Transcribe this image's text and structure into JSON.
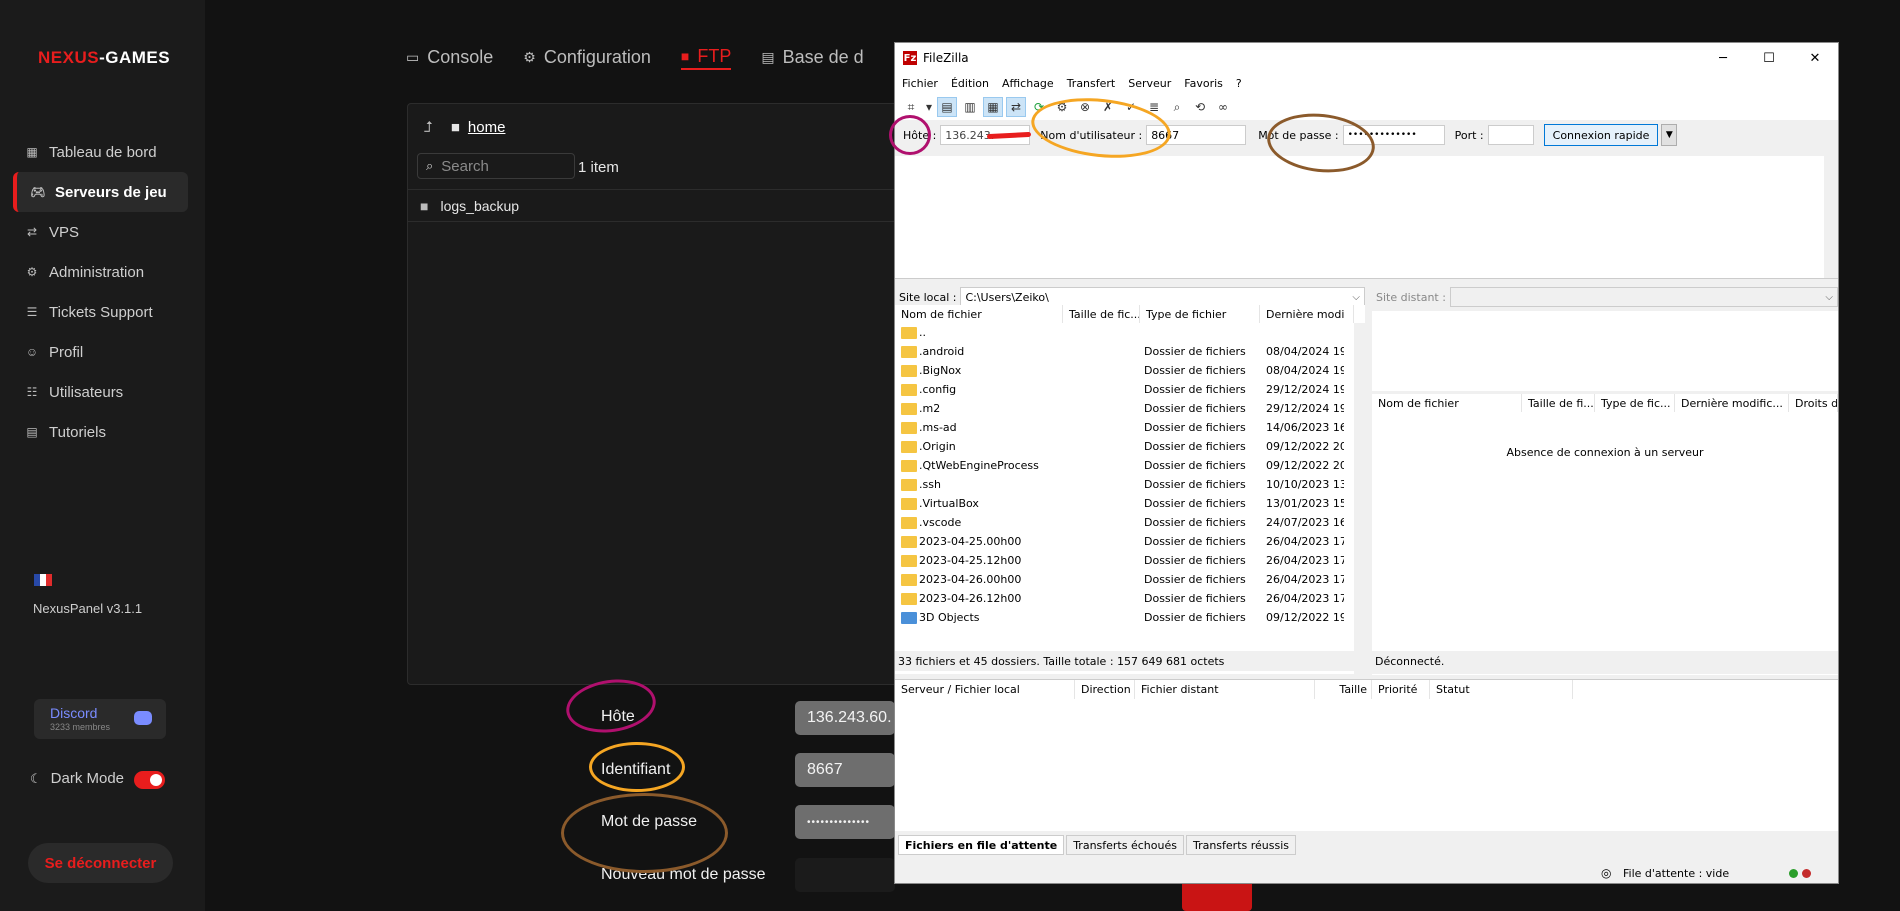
{
  "sidebar": {
    "logo_prefix": "NEXUS",
    "logo_suffix": "-GAMES",
    "items": [
      {
        "label": "Tableau de bord",
        "icon": "dashboard-icon"
      },
      {
        "label": "Serveurs de jeu",
        "icon": "gamepad-icon",
        "active": true
      },
      {
        "label": "VPS",
        "icon": "vps-icon"
      },
      {
        "label": "Administration",
        "icon": "gear-icon"
      },
      {
        "label": "Tickets Support",
        "icon": "ticket-icon"
      },
      {
        "label": "Profil",
        "icon": "user-icon"
      },
      {
        "label": "Utilisateurs",
        "icon": "users-icon"
      },
      {
        "label": "Tutoriels",
        "icon": "book-icon"
      }
    ],
    "version": "NexusPanel v3.1.1",
    "discord_label": "Discord",
    "discord_members": "3233 membres",
    "dark_mode_label": "Dark Mode",
    "logout_label": "Se déconnecter"
  },
  "main": {
    "tabs": [
      {
        "label": "Console",
        "icon": "terminal-icon"
      },
      {
        "label": "Configuration",
        "icon": "gears-icon"
      },
      {
        "label": "FTP",
        "icon": "folder-icon",
        "active": true
      },
      {
        "label": "Base de d",
        "icon": "database-icon"
      }
    ],
    "breadcrumb_home": "home",
    "search_placeholder": "Search",
    "item_count": "1 item",
    "files": [
      "logs_backup"
    ],
    "form": {
      "host_label": "Hôte",
      "host_value": "136.243.60.",
      "user_label": "Identifiant",
      "user_value": "8667",
      "password_label": "Mot de passe",
      "password_value": "••••••••••••••",
      "new_password_label": "Nouveau mot de passe"
    }
  },
  "filezilla": {
    "title": "FileZilla",
    "menu": [
      "Fichier",
      "Édition",
      "Affichage",
      "Transfert",
      "Serveur",
      "Favoris",
      "?"
    ],
    "quickconnect": {
      "host_label": "Hôte :",
      "host_value": "136.243.",
      "user_label": "Nom d'utilisateur :",
      "user_value": "8667",
      "pass_label": "Mot de passe :",
      "pass_value": "•••••••••••••",
      "port_label": "Port :",
      "port_value": "",
      "button": "Connexion rapide"
    },
    "local_site_label": "Site local :",
    "local_site_value": "C:\\Users\\Zeiko\\",
    "remote_site_label": "Site distant :",
    "local_columns": [
      "Nom de fichier",
      "Taille de fic...",
      "Type de fichier",
      "Dernière modi"
    ],
    "local_files": [
      {
        "name": "..",
        "type": "",
        "date": ""
      },
      {
        "name": ".android",
        "type": "Dossier de fichiers",
        "date": "08/04/2024 19"
      },
      {
        "name": ".BigNox",
        "type": "Dossier de fichiers",
        "date": "08/04/2024 19"
      },
      {
        "name": ".config",
        "type": "Dossier de fichiers",
        "date": "29/12/2024 19"
      },
      {
        "name": ".m2",
        "type": "Dossier de fichiers",
        "date": "29/12/2024 19"
      },
      {
        "name": ".ms-ad",
        "type": "Dossier de fichiers",
        "date": "14/06/2023 16"
      },
      {
        "name": ".Origin",
        "type": "Dossier de fichiers",
        "date": "09/12/2022 20"
      },
      {
        "name": ".QtWebEngineProcess",
        "type": "Dossier de fichiers",
        "date": "09/12/2022 20"
      },
      {
        "name": ".ssh",
        "type": "Dossier de fichiers",
        "date": "10/10/2023 13"
      },
      {
        "name": ".VirtualBox",
        "type": "Dossier de fichiers",
        "date": "13/01/2023 15"
      },
      {
        "name": ".vscode",
        "type": "Dossier de fichiers",
        "date": "24/07/2023 16"
      },
      {
        "name": "2023-04-25.00h00",
        "type": "Dossier de fichiers",
        "date": "26/04/2023 17"
      },
      {
        "name": "2023-04-25.12h00",
        "type": "Dossier de fichiers",
        "date": "26/04/2023 17"
      },
      {
        "name": "2023-04-26.00h00",
        "type": "Dossier de fichiers",
        "date": "26/04/2023 17"
      },
      {
        "name": "2023-04-26.12h00",
        "type": "Dossier de fichiers",
        "date": "26/04/2023 17"
      },
      {
        "name": "3D Objects",
        "type": "Dossier de fichiers",
        "date": "09/12/2022 19"
      }
    ],
    "local_status": "33 fichiers et 45 dossiers. Taille totale : 157 649 681 octets",
    "remote_columns": [
      "Nom de fichier",
      "Taille de fi...",
      "Type de fic...",
      "Dernière modific...",
      "Droits d"
    ],
    "remote_message": "Absence de connexion à un serveur",
    "remote_status": "Déconnecté.",
    "queue_columns": [
      "Serveur / Fichier local",
      "Direction",
      "Fichier distant",
      "Taille",
      "Priorité",
      "Statut"
    ],
    "queue_tabs": [
      "Fichiers en file d'attente",
      "Transferts échoués",
      "Transferts réussis"
    ],
    "queue_status": "File d'attente : vide"
  },
  "colors": {
    "accent": "#e81d1d",
    "annotation_host": "#b0106e",
    "annotation_user": "#f5a623",
    "annotation_password": "#8b5a2b"
  }
}
